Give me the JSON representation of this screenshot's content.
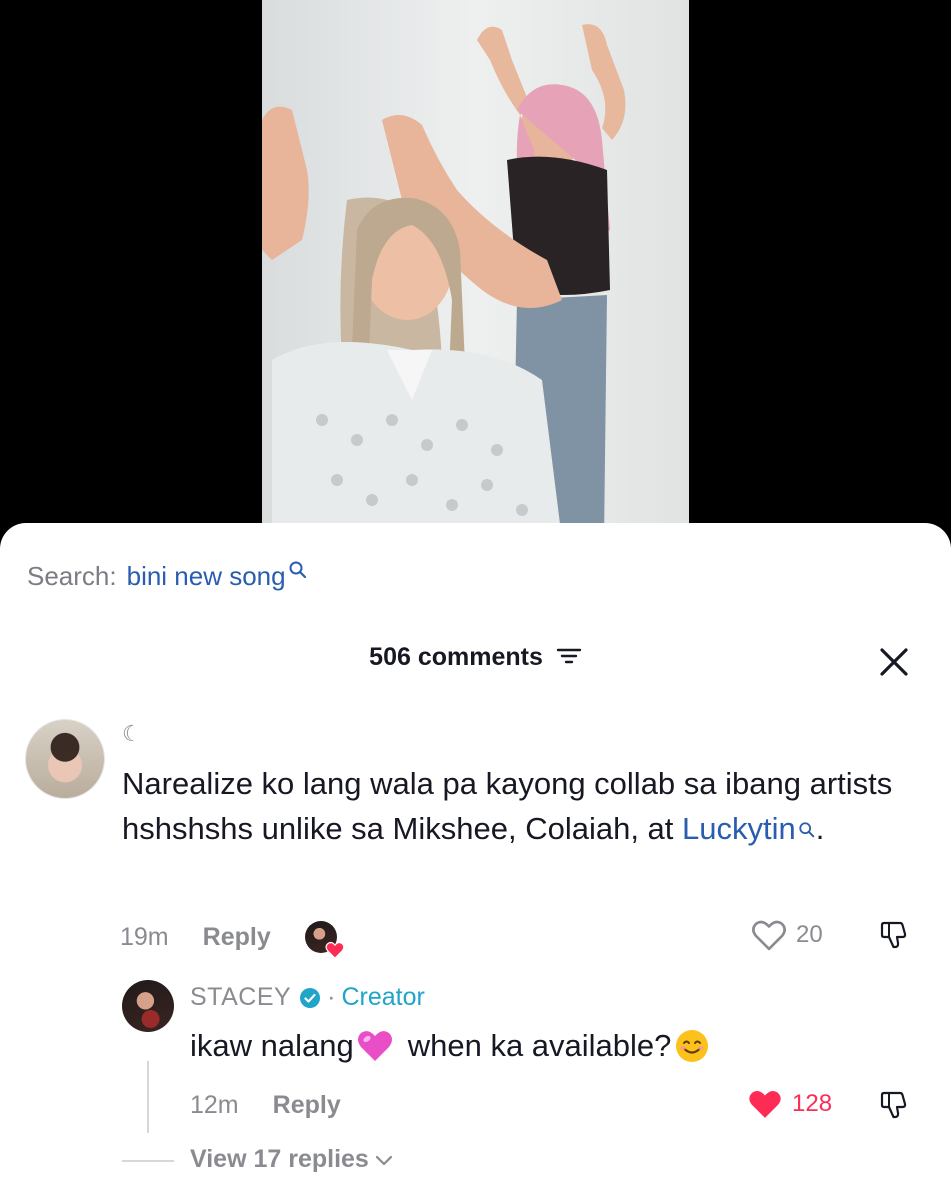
{
  "search": {
    "label": "Search:",
    "term": "bini new song"
  },
  "comments": {
    "count_label": "506 comments"
  },
  "comment": {
    "username_glyph": "☾",
    "text_main": "Narealize ko lang wala pa kayong collab sa ibang artists hshshshs unlike sa Mikshee, Colaiah, at ",
    "text_link": "Luckytin",
    "text_end": ".",
    "time": "19m",
    "reply_label": "Reply",
    "likes": "20"
  },
  "creator_reply": {
    "name": "STACEY",
    "separator": "·",
    "tag": "Creator",
    "text_part1": "ikaw nalang",
    "text_part2": "when ka available?",
    "time": "12m",
    "reply_label": "Reply",
    "likes": "128"
  },
  "view_replies": {
    "label": "View 17 replies"
  },
  "colors": {
    "link_blue": "#2a5db0",
    "creator_tag": "#20a4c8",
    "like_red": "#fe2c55",
    "muted_gray": "#8a8b91"
  },
  "icons": [
    "search-icon",
    "filter-icon",
    "close-icon",
    "heart-outline-icon",
    "heart-filled-icon",
    "dislike-icon",
    "verified-icon",
    "chevron-down-icon"
  ]
}
